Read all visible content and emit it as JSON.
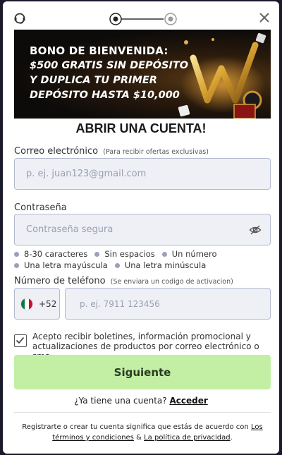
{
  "banner": {
    "line1": "BONO DE BIENVENIDA:",
    "line2": "$500 GRATIS SIN DEPÓSITO",
    "line3": "Y DUPLICA TU PRIMER",
    "line4": "DEPÓSITO HASTA $10,000"
  },
  "form": {
    "title": "ABRIR UNA CUENTA!",
    "email": {
      "label": "Correo electrónico",
      "hint": "(Para recibir ofertas exclusivas)",
      "placeholder": "p. ej. juan123@gmail.com"
    },
    "password": {
      "label": "Contraseña",
      "placeholder": "Contraseña segura",
      "rules_row1": [
        "8-30 caracteres",
        "Sin espacios",
        "Un número"
      ],
      "rules_row2": [
        "Una letra mayúscula",
        "Una letra minúscula"
      ]
    },
    "phone": {
      "label": "Número de teléfono",
      "hint": "(Se enviara un codigo de activacion)",
      "country_code": "+52",
      "placeholder": "p. ej. 7911 123456"
    },
    "consent": {
      "checked": true,
      "text": "Acepto recibir boletines, información promocional y actualizaciones de productos por correo electrónico o sms"
    },
    "next_button": "Siguiente",
    "login_prompt": "¿Ya tiene una cuenta?",
    "login_link": "Acceder",
    "terms": {
      "prefix": "Registrarte o crear tu cuenta significa que estás de acuerdo con",
      "link1": "Los términos y condiciones",
      "amp": "&",
      "link2": "La política de privacidad",
      "suffix": "."
    }
  },
  "colors": {
    "button_bg": "#c2efa4",
    "field_bg": "#eef0f6",
    "dot": "#9aa0bd"
  }
}
